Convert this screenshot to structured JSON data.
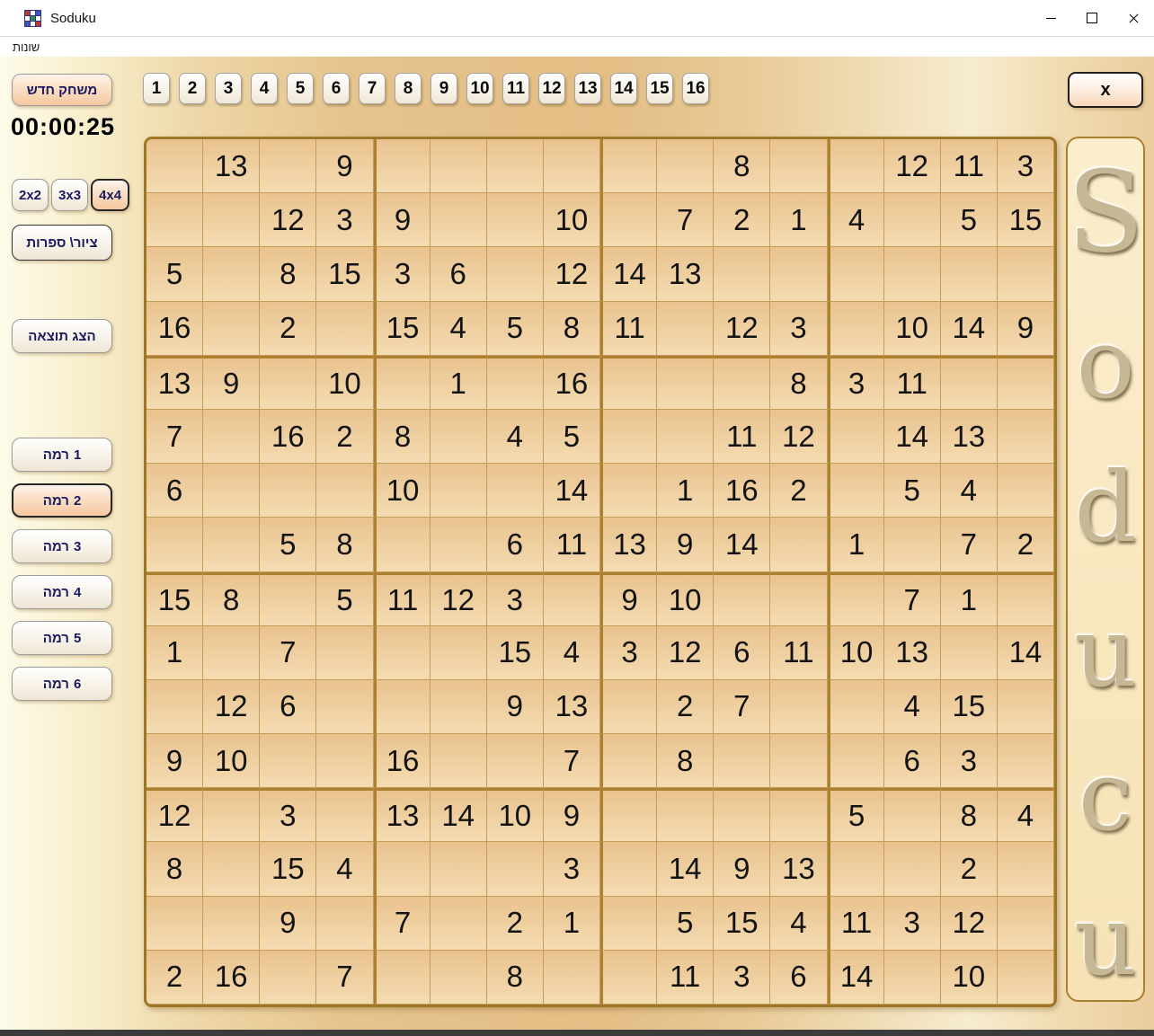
{
  "window": {
    "title": "Soduku"
  },
  "menubar": {
    "items": [
      "שונות"
    ]
  },
  "sidebar": {
    "new_game_label": "משחק חדש",
    "timer": "00:00:25",
    "size_buttons": [
      {
        "label": "2x2",
        "selected": false
      },
      {
        "label": "3x3",
        "selected": false
      },
      {
        "label": "4x4",
        "selected": true
      }
    ],
    "mode_label": "ציור\\ ספרות",
    "show_result_label": "הצג תוצאה",
    "levels": [
      {
        "label": "רמה 1",
        "selected": false
      },
      {
        "label": "רמה 2",
        "selected": true
      },
      {
        "label": "רמה 3",
        "selected": false
      },
      {
        "label": "רמה 4",
        "selected": false
      },
      {
        "label": "רמה 5",
        "selected": false
      },
      {
        "label": "רמה 6",
        "selected": false
      }
    ]
  },
  "toolbar": {
    "number_buttons": [
      "1",
      "2",
      "3",
      "4",
      "5",
      "6",
      "7",
      "8",
      "9",
      "10",
      "11",
      "12",
      "13",
      "14",
      "15",
      "16"
    ]
  },
  "exit_label": "x",
  "logo": {
    "letters": [
      "S",
      "o",
      "d",
      "u",
      "c",
      "u"
    ]
  },
  "grid": {
    "rows": [
      [
        "",
        "13",
        "",
        "9",
        "",
        "",
        "",
        "",
        "",
        "",
        "8",
        "",
        "",
        "12",
        "11",
        "3"
      ],
      [
        "",
        "",
        "12",
        "3",
        "9",
        "",
        "",
        "10",
        "",
        "7",
        "2",
        "1",
        "4",
        "",
        "5",
        "15"
      ],
      [
        "5",
        "",
        "8",
        "15",
        "3",
        "6",
        "",
        "12",
        "14",
        "13",
        "",
        "",
        "",
        "",
        "",
        ""
      ],
      [
        "16",
        "",
        "2",
        "",
        "15",
        "4",
        "5",
        "8",
        "11",
        "",
        "12",
        "3",
        "",
        "10",
        "14",
        "9"
      ],
      [
        "13",
        "9",
        "",
        "10",
        "",
        "1",
        "",
        "16",
        "",
        "",
        "",
        "8",
        "3",
        "11",
        "",
        ""
      ],
      [
        "7",
        "",
        "16",
        "2",
        "8",
        "",
        "4",
        "5",
        "",
        "",
        "11",
        "12",
        "",
        "14",
        "13",
        ""
      ],
      [
        "6",
        "",
        "",
        "",
        "10",
        "",
        "",
        "14",
        "",
        "1",
        "16",
        "2",
        "",
        "5",
        "4",
        ""
      ],
      [
        "",
        "",
        "5",
        "8",
        "",
        "",
        "6",
        "11",
        "13",
        "9",
        "14",
        "",
        "1",
        "",
        "7",
        "2"
      ],
      [
        "15",
        "8",
        "",
        "5",
        "11",
        "12",
        "3",
        "",
        "9",
        "10",
        "",
        "",
        "",
        "7",
        "1",
        ""
      ],
      [
        "1",
        "",
        "7",
        "",
        "",
        "",
        "15",
        "4",
        "3",
        "12",
        "6",
        "11",
        "10",
        "13",
        "",
        "14"
      ],
      [
        "",
        "12",
        "6",
        "",
        "",
        "",
        "9",
        "13",
        "",
        "2",
        "7",
        "",
        "",
        "4",
        "15",
        ""
      ],
      [
        "9",
        "10",
        "",
        "",
        "16",
        "",
        "",
        "7",
        "",
        "8",
        "",
        "",
        "",
        "6",
        "3",
        ""
      ],
      [
        "12",
        "",
        "3",
        "",
        "13",
        "14",
        "10",
        "9",
        "",
        "",
        "",
        "",
        "5",
        "",
        "8",
        "4"
      ],
      [
        "8",
        "",
        "15",
        "4",
        "",
        "",
        "",
        "3",
        "",
        "14",
        "9",
        "13",
        "",
        "",
        "2",
        ""
      ],
      [
        "",
        "",
        "9",
        "",
        "7",
        "",
        "2",
        "1",
        "",
        "5",
        "15",
        "4",
        "11",
        "3",
        "12",
        ""
      ],
      [
        "2",
        "16",
        "",
        "7",
        "",
        "",
        "8",
        "",
        "",
        "11",
        "3",
        "6",
        "14",
        "",
        "10",
        ""
      ]
    ]
  },
  "colors": {
    "accent_peach": "#f5c89f",
    "grid_thin_line": "#c59c58",
    "grid_block_line": "#ab8030",
    "grid_border": "#9e7628",
    "cell_top": "#e9c28e",
    "cell_bottom": "#f4dcb2",
    "button_text_navy": "#191960"
  }
}
